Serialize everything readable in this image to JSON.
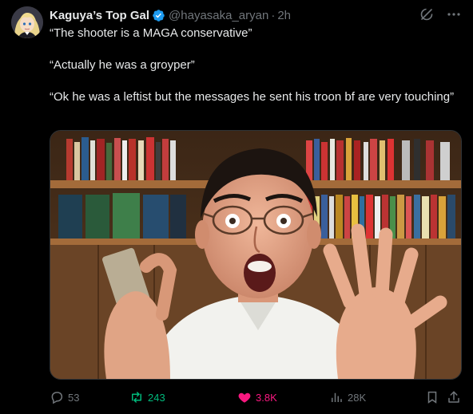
{
  "tweet": {
    "display_name": "Kaguya’s Top Gal",
    "handle": "@hayasaka_aryan",
    "separator": "·",
    "time": "2h",
    "lines": [
      "“The shooter is a MAGA conservative”",
      "“Actually he was a groyper”",
      "“Ok he was a leftist but the messages he sent his troon bf are very touching”"
    ]
  },
  "actions": {
    "replies": "53",
    "reposts": "243",
    "likes": "3.8K",
    "views": "28K"
  },
  "icons": {
    "avatar": "anime-avatar-icon",
    "verified": "verified-badge-icon",
    "grok": "grok-icon",
    "more": "more-options-icon",
    "reply": "reply-icon",
    "repost": "repost-icon",
    "like": "heart-icon",
    "views": "views-icon",
    "bookmark": "bookmark-icon",
    "share": "share-icon"
  },
  "colors": {
    "background": "#000000",
    "text": "#e7e9ea",
    "muted": "#71767b",
    "verified": "#1d9bf0",
    "repost_active": "#00ba7c",
    "like_active": "#f91880"
  }
}
